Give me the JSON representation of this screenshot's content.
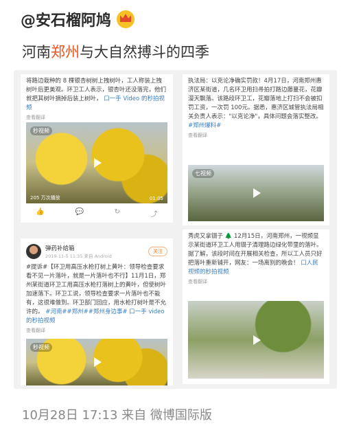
{
  "post": {
    "author": "@安石榴阿鸠",
    "headline_pre": "河南",
    "headline_hl": "郑州",
    "headline_post": "与大自然搏斗的四季",
    "footer": "10月28日 17:13 来自 微博国际版"
  },
  "cards": [
    {
      "text": "将路边栽种的 8 棵银杏树树上拽树叶，工人称装上拽树叶后更美观。环卫工人表示，银杏叶还没落完，他们就把其树叶摘掉后装上树叶，",
      "link": "口一手 Video 的秒拍视频",
      "meta": "查看翻译",
      "video_label": "秒视频",
      "video_views": "205 万次播放",
      "video_time": "01:05"
    },
    {
      "text": "执法局：以克论净确实罚款！4月17日，河南郑州惠济区某街道，几名环卫用扫帚拍打路边藤蔓花，花瓣漫天飘落。该路段环卫工，花瓣落地上打扫不会被扣罚工资，一次罚 100元。据悉，惠济区城管执法局相关负责人表示：\"以克论净\"，具体问题会落实整改。",
      "link": "#郑州爆料#",
      "meta": "查看翻译",
      "video_label": "七视频"
    },
    {
      "user": "弹药补给箱",
      "time": "2019-11-5 11:35 来自 Android",
      "follow": "关注",
      "text": "#提诉#【环卫用高压水枪打树上黄叶：领导检查要求看不见一片落叶，就是一片落叶也不行】11月1日，郑州某街道环卫工用高压水枪打落树上的黄叶，但使树叶加速落下。环卫工说，领导检查要求一片落叶也不能有，这很难做到。环卫部门回应，用水枪打树叶是不允许的。",
      "link": "#河南##郑州##郑州身边事# 口一手 video 的秒拍视频",
      "meta": "查看翻译",
      "video_label": "秒视频"
    },
    {
      "text": "秀虎又拿镊子 🌲 12月15日，河南郑州，一视频显示某街道环卫工人用镊子清理路边绿化带里的落叶。据了解，该段时间在开展相关检查，所以工人员只好把落叶重新铺开，网友：一场离别的晚会！",
      "link": "口人民视频的秒拍视频",
      "meta": "查看翻译"
    }
  ]
}
